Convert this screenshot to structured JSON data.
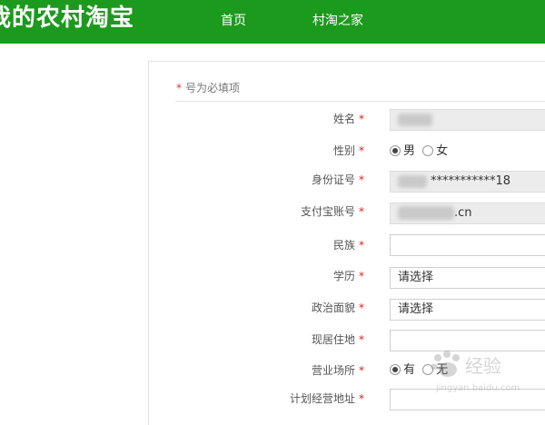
{
  "header": {
    "brand": "我的农村淘宝",
    "nav": [
      "首页",
      "村淘之家"
    ],
    "color": "#1c9a1d"
  },
  "form": {
    "required_note": "号为必填项",
    "required_mark": "*",
    "fields": {
      "name": {
        "label": "姓名"
      },
      "gender": {
        "label": "性别",
        "options": [
          "男",
          "女"
        ],
        "selected": "男"
      },
      "id_number": {
        "label": "身份证号",
        "value": "***********18"
      },
      "alipay": {
        "label": "支付宝账号",
        "value": ".cn"
      },
      "ethnicity": {
        "label": "民族"
      },
      "education": {
        "label": "学历",
        "value": "请选择"
      },
      "political": {
        "label": "政治面貌",
        "value": "请选择"
      },
      "residence": {
        "label": "现居住地"
      },
      "business_place": {
        "label": "营业场所",
        "options": [
          "有",
          "无"
        ],
        "selected": "有"
      },
      "planned_address": {
        "label": "计划经营地址"
      }
    }
  },
  "watermark": {
    "text": "经验",
    "url_text": "jingyan.baidu.com",
    "icon": "baidu-paw-icon"
  }
}
